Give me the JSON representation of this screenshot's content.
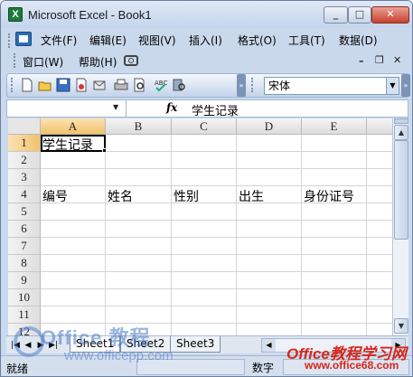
{
  "window": {
    "title": "Microsoft Excel - Book1",
    "app_icon": "X"
  },
  "menu": {
    "row1": [
      "文件(F)",
      "编辑(E)",
      "视图(V)",
      "插入(I)",
      "格式(O)",
      "工具(T)",
      "数据(D)"
    ],
    "row2": [
      "窗口(W)",
      "帮助(H)"
    ]
  },
  "toolbar": {
    "font_name": "宋体"
  },
  "formula": {
    "name_box": "",
    "fx_label": "fx",
    "content": "学生记录"
  },
  "grid": {
    "columns": [
      "A",
      "B",
      "C",
      "D",
      "E"
    ],
    "rows": [
      "1",
      "2",
      "3",
      "4",
      "5",
      "6",
      "7",
      "8",
      "9",
      "10",
      "11",
      "12"
    ],
    "cells": {
      "A1": "学生记录",
      "A4": "编号",
      "B4": "姓名",
      "C4": "性别",
      "D4": "出生",
      "E4": "身份证号"
    },
    "selected_cell": "A1"
  },
  "sheets": [
    "Sheet1",
    "Sheet2",
    "Sheet3"
  ],
  "active_sheet": "Sheet1",
  "status": {
    "left": "就绪",
    "mode": "数字"
  },
  "watermarks": {
    "left_brand": "Office 教程",
    "left_url": "www.officepp.com",
    "right_brand": "Office教程学习网",
    "right_url": "www.office68.com"
  },
  "colors": {
    "selection_header": "#f2c26b",
    "close_button": "#c7402d",
    "watermark_red": "#d8261b"
  }
}
